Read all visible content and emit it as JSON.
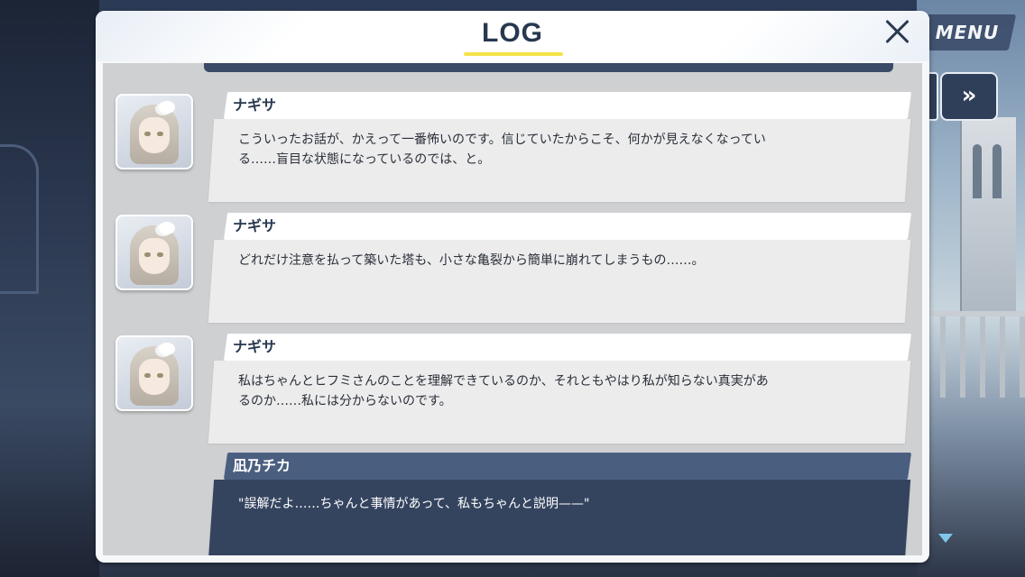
{
  "header": {
    "menu_label": "MENU",
    "log_title": "LOG"
  },
  "controls": {
    "fast_forward_icon": "double-chevron-right-icon",
    "close_icon": "close-icon",
    "scroll_down_icon": "triangle-down-icon"
  },
  "colors": {
    "title_underline": "#f4e24a",
    "player_name_bar": "#4a5f80",
    "player_message_bg": "#34445f",
    "npc_message_bg": "#ececed"
  },
  "entries": [
    {
      "speaker": "ナギサ",
      "lines": [
        "こういったお話が、かえって一番怖いのです。信じていたからこそ、何かが見えなくなってい",
        "る……盲目な状態になっているのでは、と。"
      ]
    },
    {
      "speaker": "ナギサ",
      "lines": [
        "どれだけ注意を払って築いた塔も、小さな亀裂から簡単に崩れてしまうもの……。"
      ]
    },
    {
      "speaker": "ナギサ",
      "lines": [
        "私はちゃんとヒフミさんのことを理解できているのか、それともやはり私が知らない真実があ",
        "るのか……私には分からないのです。"
      ]
    },
    {
      "speaker": "凪乃チカ",
      "lines": [
        "\"誤解だよ……ちゃんと事情があって、私もちゃんと説明——\""
      ]
    }
  ]
}
